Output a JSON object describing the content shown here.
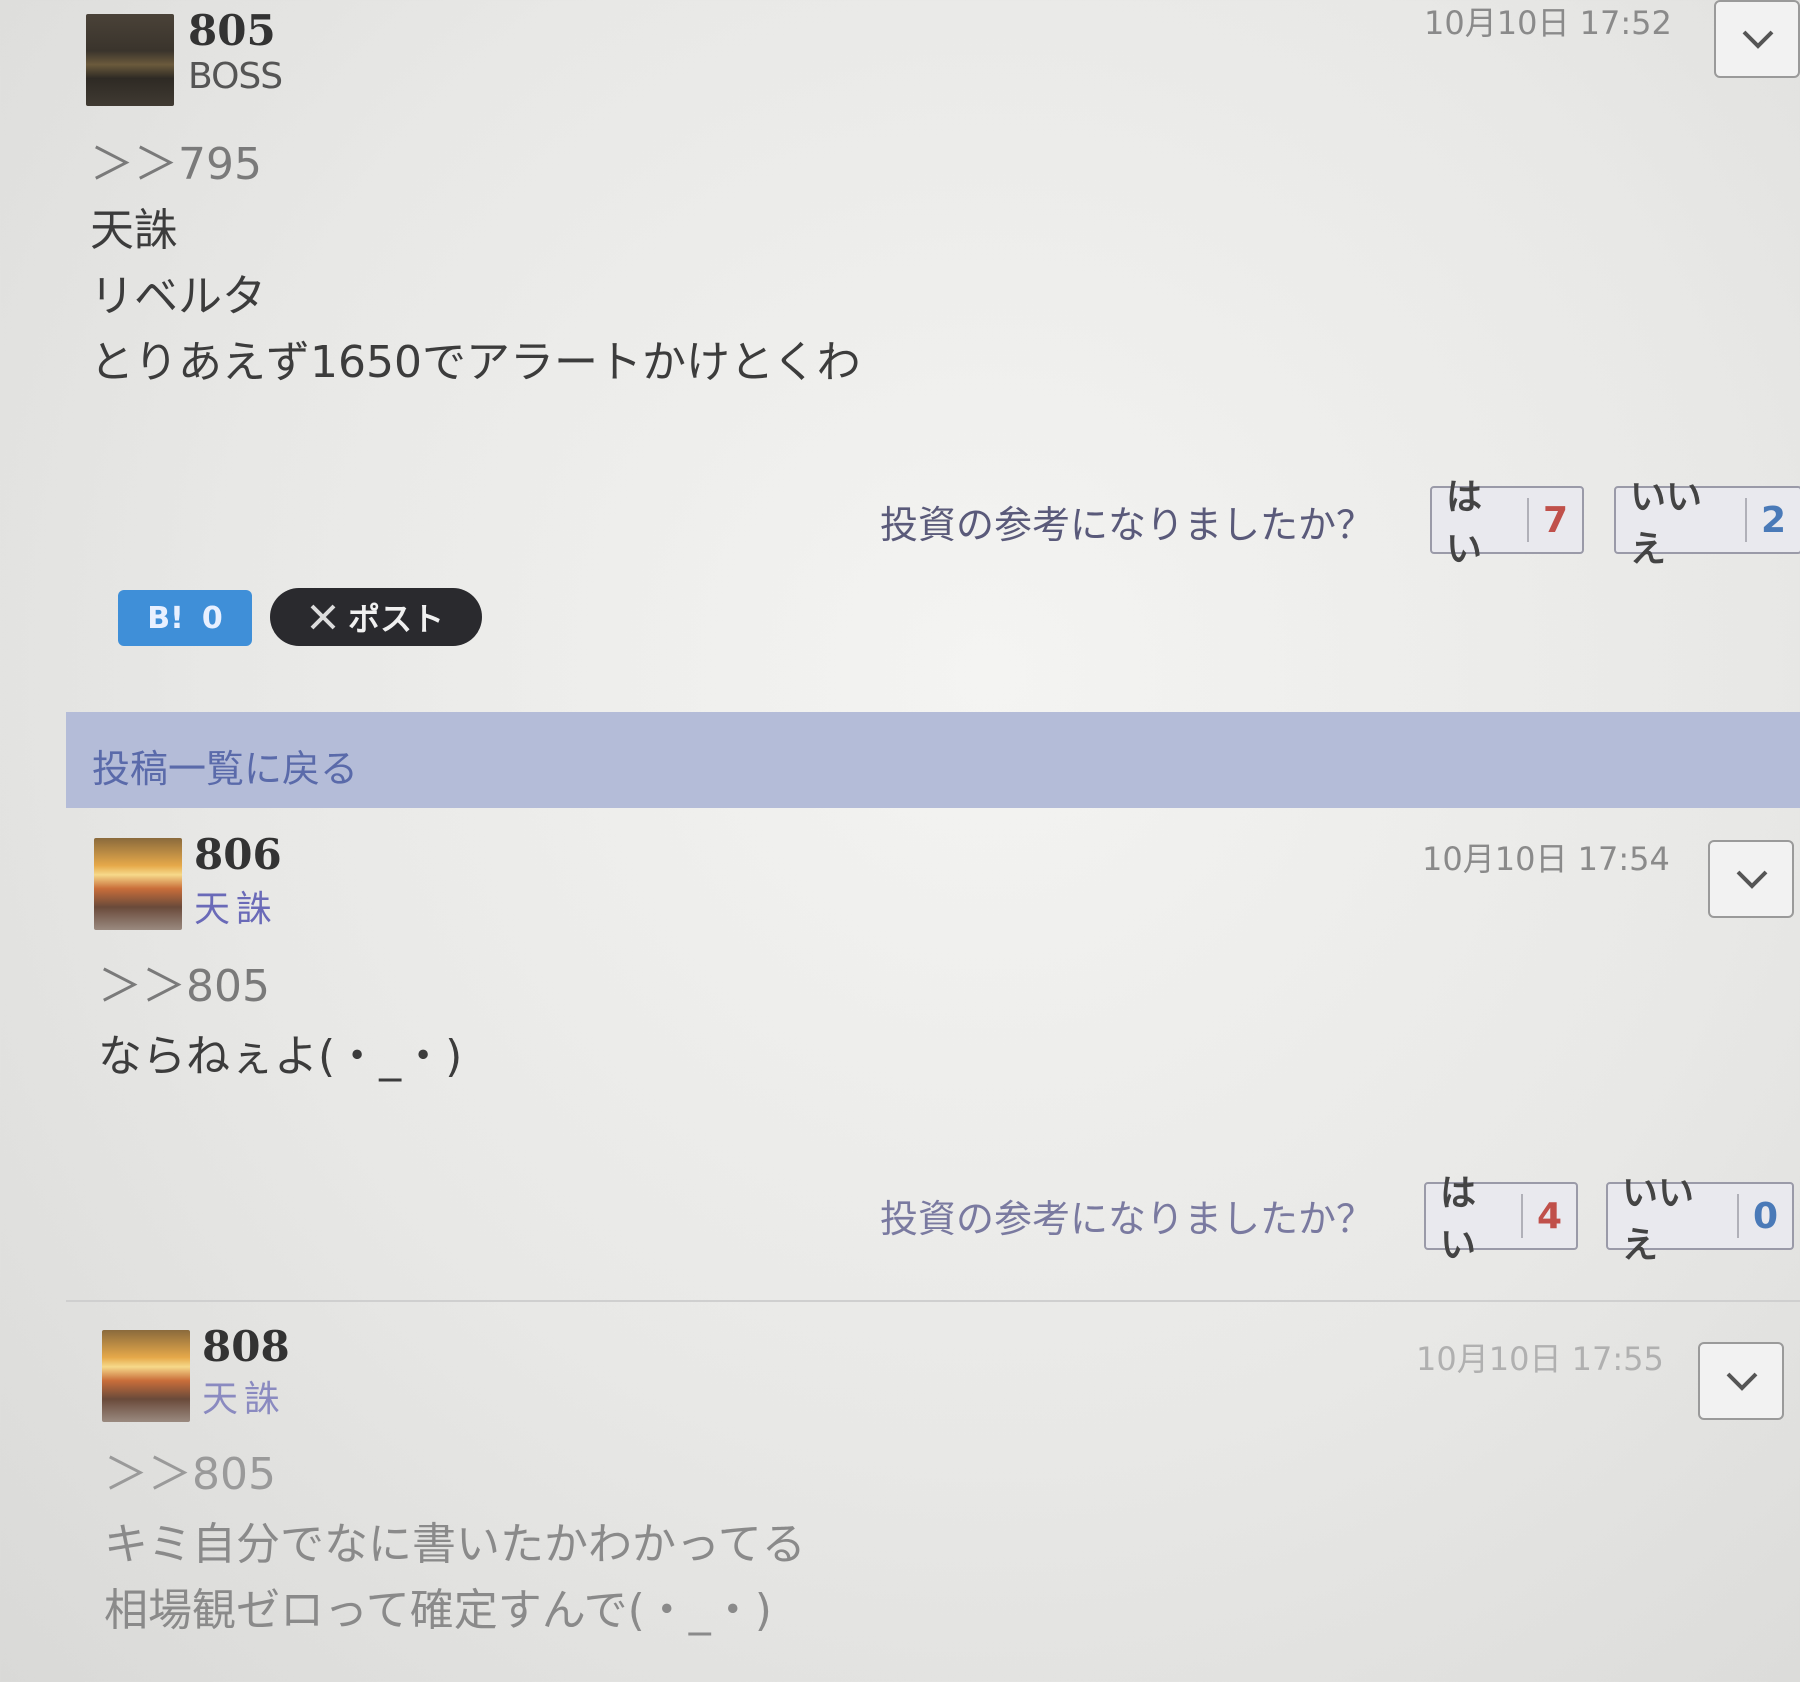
{
  "posts": [
    {
      "number": "805",
      "username": "BOSS",
      "date": "10月10日 17:52",
      "anchor": "＞＞795",
      "lines": [
        "天誅",
        "リベルタ",
        "とりあえず1650でアラートかけとくわ"
      ],
      "vote_question": "投資の参考になりましたか？",
      "yes_label": "はい",
      "yes_count": "7",
      "no_label": "いいえ",
      "no_count": "2"
    },
    {
      "number": "806",
      "username": "天誅",
      "date": "10月10日 17:54",
      "anchor": "＞＞805",
      "lines": [
        "ならねぇよ(・_・)"
      ],
      "vote_question": "投資の参考になりましたか？",
      "yes_label": "はい",
      "yes_count": "4",
      "no_label": "いいえ",
      "no_count": "0"
    },
    {
      "number": "808",
      "username": "天誅",
      "date": "10月10日 17:55",
      "anchor": "＞＞805",
      "lines": [
        "キミ自分でなに書いたかわかってる",
        "相場観ゼロって確定すんで(・_・)"
      ]
    }
  ],
  "share": {
    "hatena_label": "B!",
    "hatena_count": "0",
    "x_label": "ポスト"
  },
  "back_link": "投稿一覧に戻る",
  "icons": {
    "menu": "chevron-down-icon",
    "x": "x-logo-icon"
  }
}
